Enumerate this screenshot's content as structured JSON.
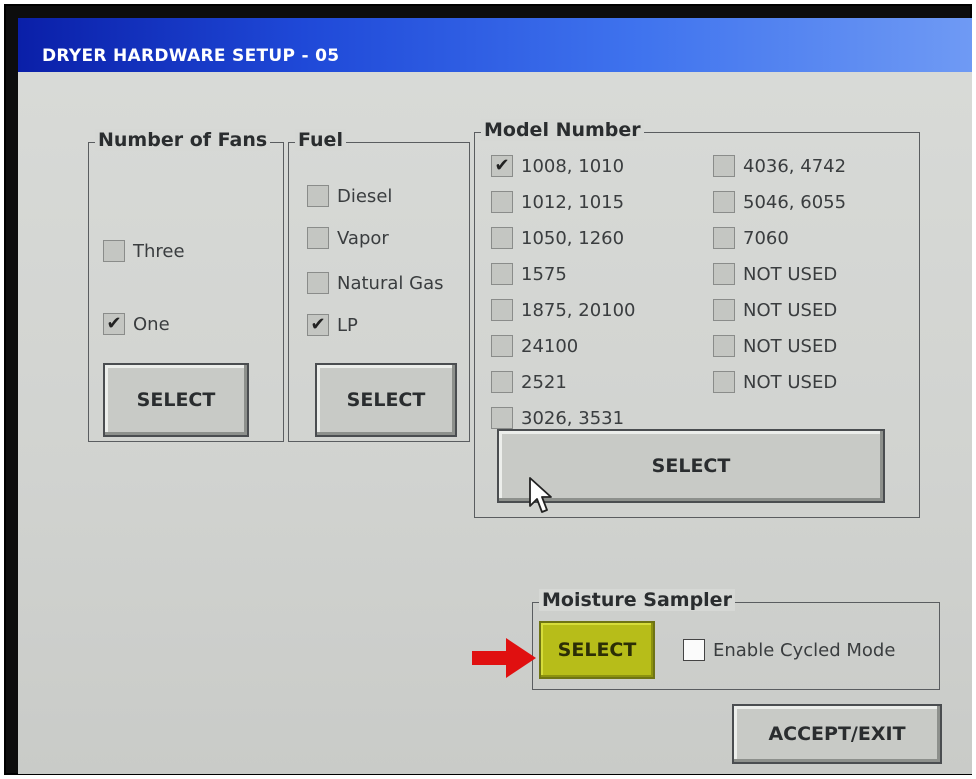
{
  "window": {
    "title": "DRYER HARDWARE SETUP - 05"
  },
  "fans": {
    "legend": "Number of Fans",
    "options": [
      {
        "label": "Three",
        "checked": false
      },
      {
        "label": "One",
        "checked": true
      }
    ],
    "select_label": "SELECT"
  },
  "fuel": {
    "legend": "Fuel",
    "options": [
      {
        "label": "Diesel",
        "checked": false
      },
      {
        "label": "Vapor",
        "checked": false
      },
      {
        "label": "Natural Gas",
        "checked": false
      },
      {
        "label": "LP",
        "checked": true
      }
    ],
    "select_label": "SELECT"
  },
  "model": {
    "legend": "Model Number",
    "left": [
      {
        "label": "1008, 1010",
        "checked": true
      },
      {
        "label": "1012, 1015",
        "checked": false
      },
      {
        "label": "1050, 1260",
        "checked": false
      },
      {
        "label": "1575",
        "checked": false
      },
      {
        "label": "1875, 20100",
        "checked": false
      },
      {
        "label": "24100",
        "checked": false
      },
      {
        "label": "2521",
        "checked": false
      },
      {
        "label": "3026, 3531",
        "checked": false
      }
    ],
    "right": [
      {
        "label": "4036, 4742",
        "checked": false
      },
      {
        "label": "5046, 6055",
        "checked": false
      },
      {
        "label": "7060",
        "checked": false
      },
      {
        "label": "NOT USED",
        "checked": false
      },
      {
        "label": "NOT USED",
        "checked": false
      },
      {
        "label": "NOT USED",
        "checked": false
      },
      {
        "label": "NOT USED",
        "checked": false
      }
    ],
    "select_label": "SELECT"
  },
  "moisture": {
    "legend": "Moisture Sampler",
    "select_label": "SELECT",
    "cycled_label": "Enable Cycled Mode",
    "cycled_checked": false
  },
  "accept_label": "ACCEPT/EXIT",
  "check_glyph": "✔",
  "colors": {
    "titlebar": "#1f49d8",
    "highlight_button": "#b7bd19",
    "arrow": "#e01010"
  },
  "icons": {
    "cursor": "mouse-pointer-icon",
    "annotation": "red-arrow-icon"
  }
}
